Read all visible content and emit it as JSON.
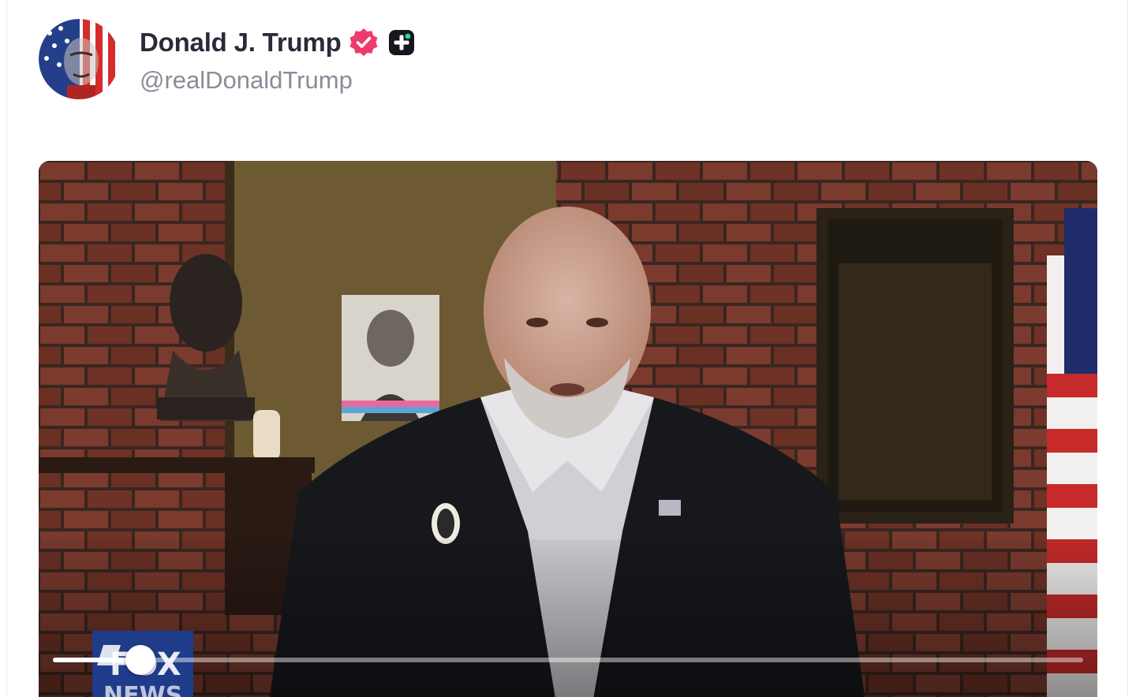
{
  "post": {
    "author_name": "Donald J. Trump",
    "handle": "@realDonaldTrump",
    "verified_color": "#ef3b6b",
    "plus_badge_color": "#16161e"
  },
  "video": {
    "progress_fraction": 0.085,
    "network_logo_text_top": "FOX",
    "network_logo_text_bottom": "NEWS"
  },
  "icons": {
    "verified": "verified-badge-icon",
    "plus": "plus-badge-icon",
    "avatar": "profile-avatar"
  }
}
